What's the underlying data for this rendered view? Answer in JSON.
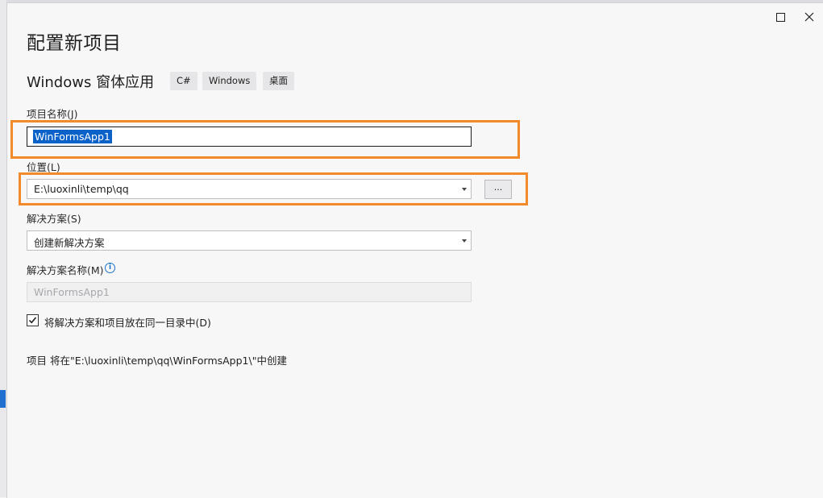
{
  "dialog": {
    "title": "配置新项目",
    "template_name": "Windows 窗体应用",
    "tags": [
      "C#",
      "Windows",
      "桌面"
    ]
  },
  "fields": {
    "project_name": {
      "label": "项目名称(J)",
      "value": "WinFormsApp1"
    },
    "location": {
      "label": "位置(L)",
      "value": "E:\\luoxinli\\temp\\qq",
      "browse_label": "..."
    },
    "solution": {
      "label": "解决方案(S)",
      "value": "创建新解决方案"
    },
    "solution_name": {
      "label": "解决方案名称(M)",
      "value": "WinFormsApp1",
      "info_icon": "i"
    },
    "same_dir": {
      "label": "将解决方案和项目放在同一目录中(D)",
      "checked": true
    }
  },
  "footer": {
    "path_info": "项目 将在\"E:\\luoxinli\\temp\\qq\\WinFormsApp1\\\"中创建"
  },
  "colors": {
    "highlight": "#f38a2a",
    "selection": "#0a62c9",
    "info": "#1a73c9"
  }
}
